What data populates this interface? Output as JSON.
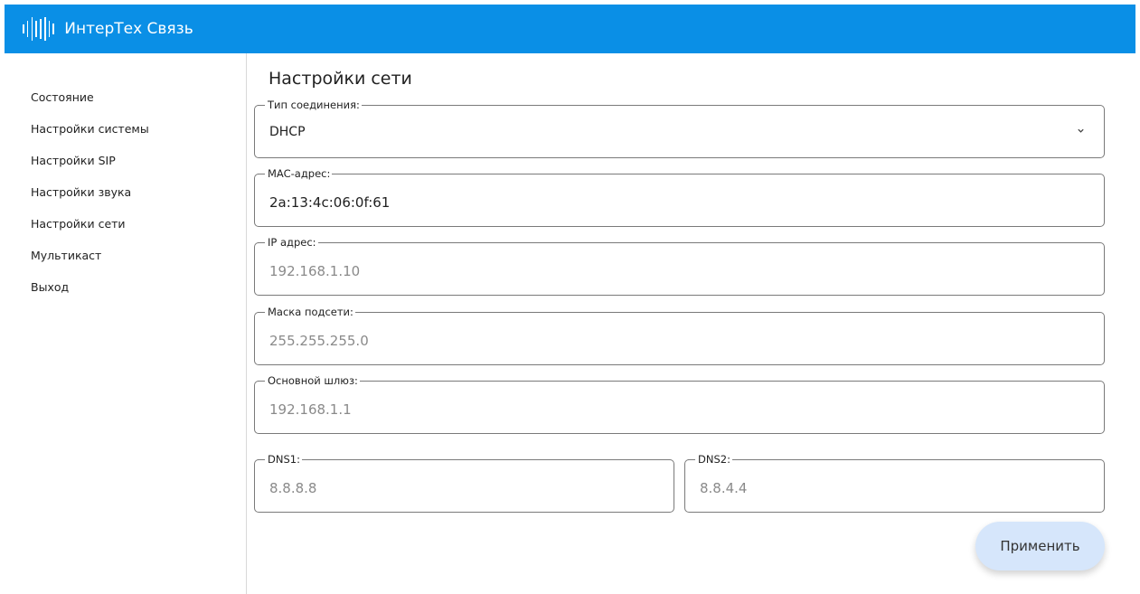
{
  "header": {
    "brand": "ИнтерТех Связь"
  },
  "sidebar": {
    "items": [
      {
        "label": "Состояние"
      },
      {
        "label": "Настройки системы"
      },
      {
        "label": "Настройки SIP"
      },
      {
        "label": "Настройки звука"
      },
      {
        "label": "Настройки сети"
      },
      {
        "label": "Мультикаст"
      },
      {
        "label": "Выход"
      }
    ]
  },
  "main": {
    "title": "Настройки сети",
    "connection_type": {
      "label": "Тип соединения:",
      "value": "DHCP"
    },
    "mac": {
      "label": "MAC-адрес:",
      "value": "2a:13:4c:06:0f:61"
    },
    "ip": {
      "label": "IP адрес:",
      "placeholder": "192.168.1.10"
    },
    "mask": {
      "label": "Маска подсети:",
      "placeholder": "255.255.255.0"
    },
    "gateway": {
      "label": "Основной шлюз:",
      "placeholder": "192.168.1.1"
    },
    "dns1": {
      "label": "DNS1:",
      "placeholder": "8.8.8.8"
    },
    "dns2": {
      "label": "DNS2:",
      "placeholder": "8.8.4.4"
    },
    "apply_label": "Применить"
  },
  "colors": {
    "header_bg": "#0a8fe6",
    "apply_bg": "#d6e6fb"
  }
}
